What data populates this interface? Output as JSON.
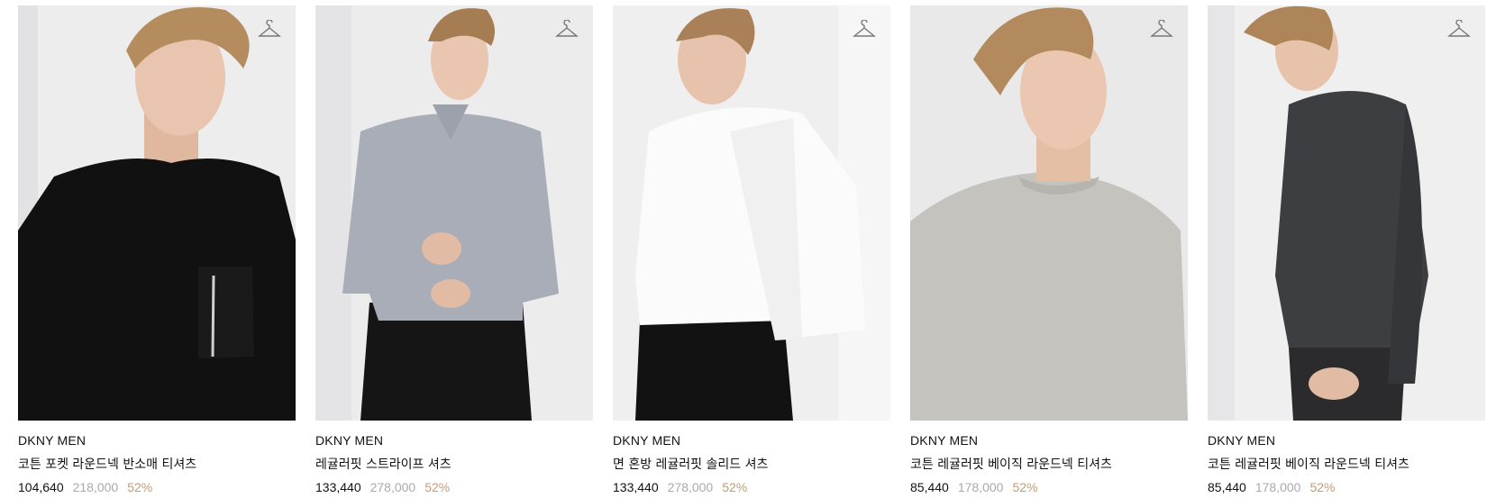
{
  "colors": {
    "background": "#ffffff",
    "text": "#111111",
    "original_price": "#aaaaaa",
    "discount": "#c79a73",
    "hanger_icon": "#777777"
  },
  "products": [
    {
      "brand": "DKNY MEN",
      "name": "코튼 포켓 라운드넥 반소매 티셔츠",
      "price": "104,640",
      "original_price": "218,000",
      "discount": "52%",
      "icon": "hanger-icon"
    },
    {
      "brand": "DKNY MEN",
      "name": "레귤러핏 스트라이프 셔츠",
      "price": "133,440",
      "original_price": "278,000",
      "discount": "52%",
      "icon": "hanger-icon"
    },
    {
      "brand": "DKNY MEN",
      "name": "면 혼방 레귤러핏 솔리드 셔츠",
      "price": "133,440",
      "original_price": "278,000",
      "discount": "52%",
      "icon": "hanger-icon"
    },
    {
      "brand": "DKNY MEN",
      "name": "코튼 레귤러핏 베이직 라운드넥 티셔츠",
      "price": "85,440",
      "original_price": "178,000",
      "discount": "52%",
      "icon": "hanger-icon"
    },
    {
      "brand": "DKNY MEN",
      "name": "코튼 레귤러핏 베이직 라운드넥 티셔츠",
      "price": "85,440",
      "original_price": "178,000",
      "discount": "52%",
      "icon": "hanger-icon"
    }
  ]
}
